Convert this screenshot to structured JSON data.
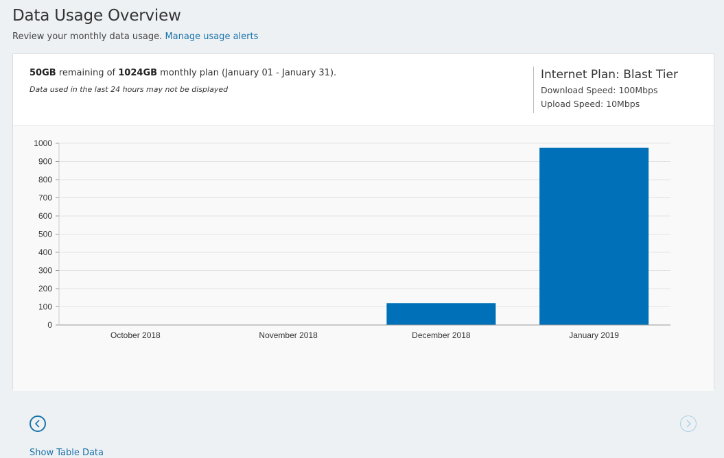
{
  "header": {
    "title": "Data Usage Overview",
    "subtitle_text": "Review your monthly data usage.",
    "alerts_link": "Manage usage alerts"
  },
  "summary": {
    "remaining": "50GB",
    "remaining_of": "remaining of",
    "plan_total": "1024GB",
    "plan_period": "monthly plan (January 01 - January 31).",
    "note": "Data used in the last 24 hours may not be displayed"
  },
  "plan": {
    "title": "Internet Plan: Blast Tier",
    "download": "Download Speed: 100Mbps",
    "upload": "Upload Speed: 10Mbps"
  },
  "controls": {
    "show_table": "Show Table Data",
    "prev_icon": "chevron-left-icon",
    "next_icon": "chevron-right-icon"
  },
  "colors": {
    "bar": "#0071b8",
    "link": "#1a73a8"
  },
  "chart_data": {
    "type": "bar",
    "categories": [
      "October 2018",
      "November 2018",
      "December 2018",
      "January 2019"
    ],
    "values": [
      0,
      0,
      120,
      975
    ],
    "ylim": [
      0,
      1000
    ],
    "yticks": [
      0,
      100,
      200,
      300,
      400,
      500,
      600,
      700,
      800,
      900,
      1000
    ],
    "grid": true
  }
}
